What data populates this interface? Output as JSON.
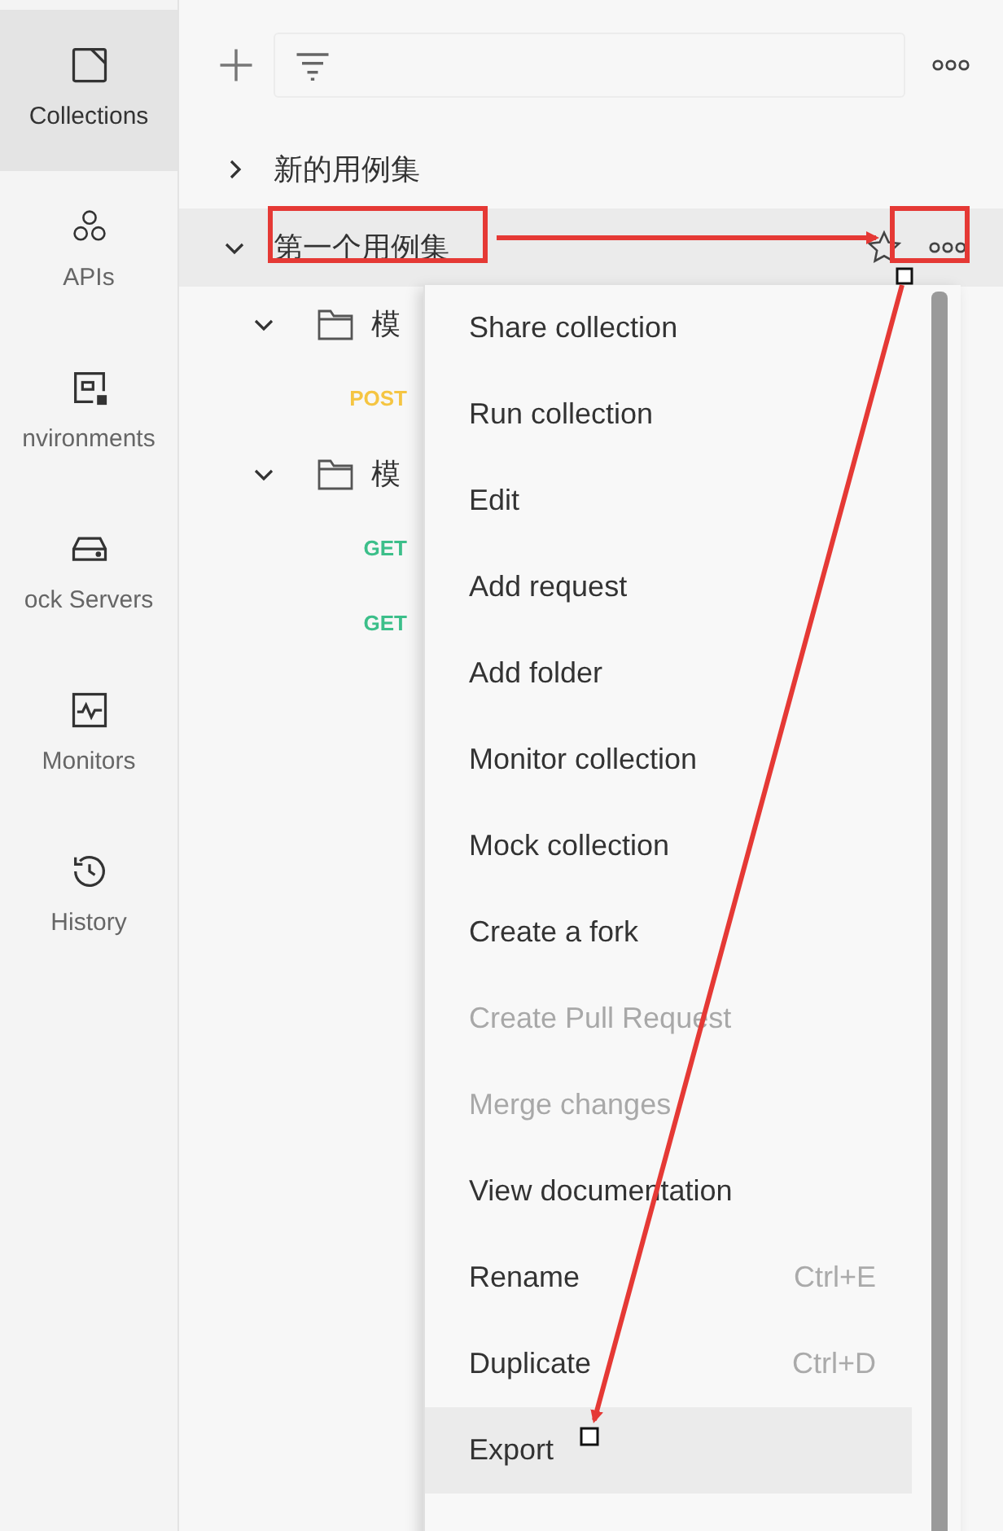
{
  "nav": [
    {
      "label": "Collections",
      "selected": true
    },
    {
      "label": "APIs",
      "selected": false
    },
    {
      "label": "nvironments",
      "selected": false
    },
    {
      "label": "ock Servers",
      "selected": false
    },
    {
      "label": "Monitors",
      "selected": false
    },
    {
      "label": "History",
      "selected": false
    }
  ],
  "tree": [
    {
      "name": "新的用例集",
      "expanded": false,
      "selected": false
    },
    {
      "name": "第一个用例集",
      "expanded": true,
      "selected": true,
      "children": [
        {
          "name": "模",
          "expanded": true,
          "children": [
            {
              "method": "POST",
              "color": "#f5c542"
            }
          ]
        },
        {
          "name": "模",
          "expanded": true,
          "children": [
            {
              "method": "GET",
              "color": "#3cbf8a"
            },
            {
              "method": "GET",
              "color": "#3cbf8a"
            }
          ]
        }
      ]
    }
  ],
  "menu": [
    {
      "label": "Share collection",
      "disabled": false,
      "selected": false
    },
    {
      "label": "Run collection",
      "disabled": false,
      "selected": false
    },
    {
      "label": "Edit",
      "disabled": false,
      "selected": false
    },
    {
      "label": "Add request",
      "disabled": false,
      "selected": false
    },
    {
      "label": "Add folder",
      "disabled": false,
      "selected": false
    },
    {
      "label": "Monitor collection",
      "disabled": false,
      "selected": false
    },
    {
      "label": "Mock collection",
      "disabled": false,
      "selected": false
    },
    {
      "label": "Create a fork",
      "disabled": false,
      "selected": false
    },
    {
      "label": "Create Pull Request",
      "disabled": true,
      "selected": false
    },
    {
      "label": "Merge changes",
      "disabled": true,
      "selected": false
    },
    {
      "label": "View documentation",
      "disabled": false,
      "selected": false
    },
    {
      "label": "Rename",
      "shortcut": "Ctrl+E",
      "disabled": false,
      "selected": false
    },
    {
      "label": "Duplicate",
      "shortcut": "Ctrl+D",
      "disabled": false,
      "selected": false
    },
    {
      "label": "Export",
      "disabled": false,
      "selected": true
    }
  ]
}
